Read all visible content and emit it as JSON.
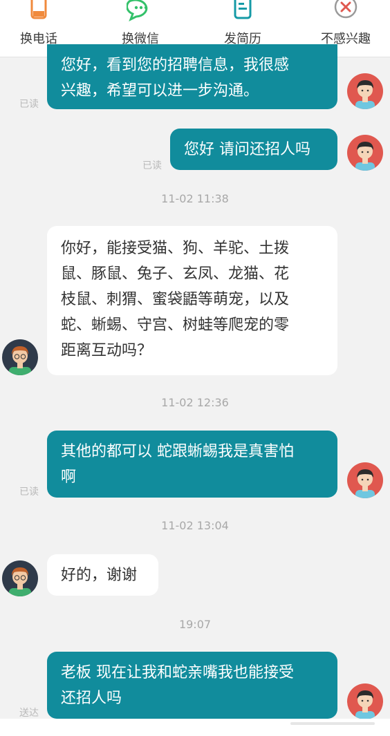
{
  "toolbar": {
    "items": [
      {
        "label": "换电话",
        "icon": "phone-icon"
      },
      {
        "label": "换微信",
        "icon": "wechat-icon"
      },
      {
        "label": "发简历",
        "icon": "resume-icon"
      },
      {
        "label": "不感兴趣",
        "icon": "not-interested-icon"
      }
    ]
  },
  "messages": [
    {
      "side": "out",
      "lines": [
        "您好，看到您的招聘信息，我很感",
        "兴趣，希望可以进一步沟通。"
      ],
      "status": "已读"
    },
    {
      "side": "out",
      "lines": [
        "您好 请问还招人吗"
      ],
      "status": "已读"
    },
    {
      "side": "in",
      "lines": [
        "你好，能接受猫、狗、羊驼、土拨",
        "鼠、豚鼠、兔子、玄凤、龙猫、花",
        "枝鼠、刺猬、蜜袋鼯等萌宠，以及",
        "蛇、蜥蜴、守宫、树蛙等爬宠的零",
        "距离互动吗？"
      ]
    },
    {
      "side": "out",
      "lines": [
        "其他的都可以 蛇跟蜥蜴我是真害怕",
        "啊"
      ],
      "status": "已读"
    },
    {
      "side": "in",
      "lines": [
        "好的，谢谢"
      ]
    },
    {
      "side": "out",
      "lines": [
        "老板 现在让我和蛇亲嘴我也能接受",
        "还招人吗"
      ],
      "status": "送达"
    }
  ],
  "timestamps": [
    "11-02 11:38",
    "11-02 12:36",
    "11-02 13:04",
    "19:07"
  ],
  "colors": {
    "outgoing_bubble": "#118c9c",
    "incoming_bubble": "#ffffff",
    "accent_orange": "#f08a3c",
    "accent_green": "#34c16a",
    "accent_teal": "#159aa6",
    "accent_red": "#e0584f"
  }
}
